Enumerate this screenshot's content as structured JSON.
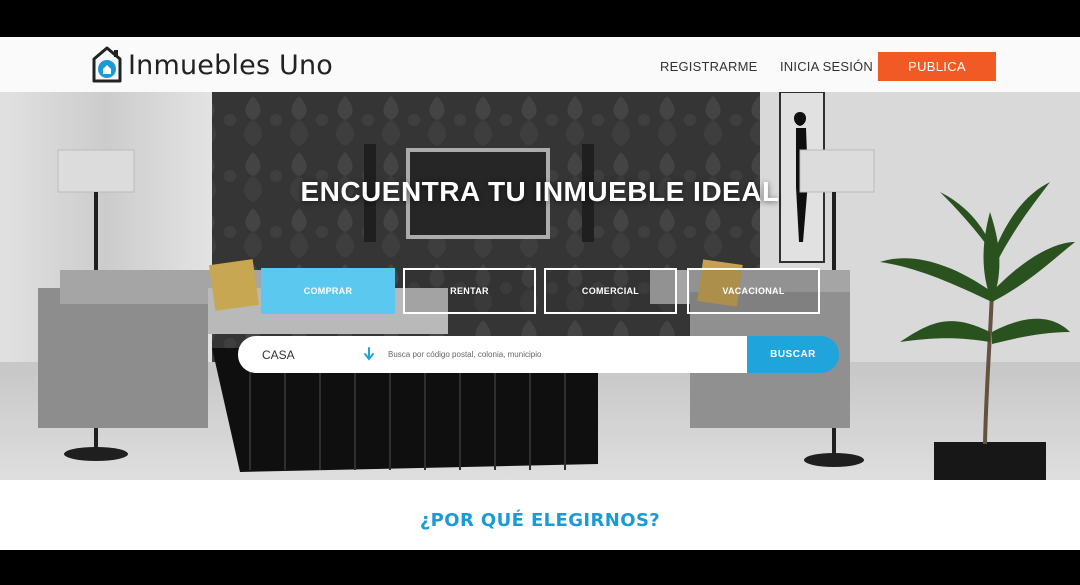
{
  "brand": {
    "name": "Inmuebles Uno",
    "accent_color": "#1c9ad6",
    "cta_color": "#f15a24"
  },
  "nav": {
    "register_label": "REGISTRARME",
    "login_label": "INICIA SESIÓN",
    "publish_label": "PUBLICA"
  },
  "hero": {
    "title": "ENCUENTRA TU  INMUEBLE IDEAL",
    "tabs": [
      {
        "label": "COMPRAR",
        "active": true
      },
      {
        "label": "RENTAR",
        "active": false
      },
      {
        "label": "COMERCIAL",
        "active": false
      },
      {
        "label": "VACACIONAL",
        "active": false
      }
    ]
  },
  "search": {
    "property_type": "CASA",
    "placeholder": "Busca por código postal, colonia, municipio",
    "button_label": "BUSCAR",
    "arrow_icon": "arrow-down-icon"
  },
  "section": {
    "title": "¿POR QUÉ ELEGIRNOS?"
  }
}
